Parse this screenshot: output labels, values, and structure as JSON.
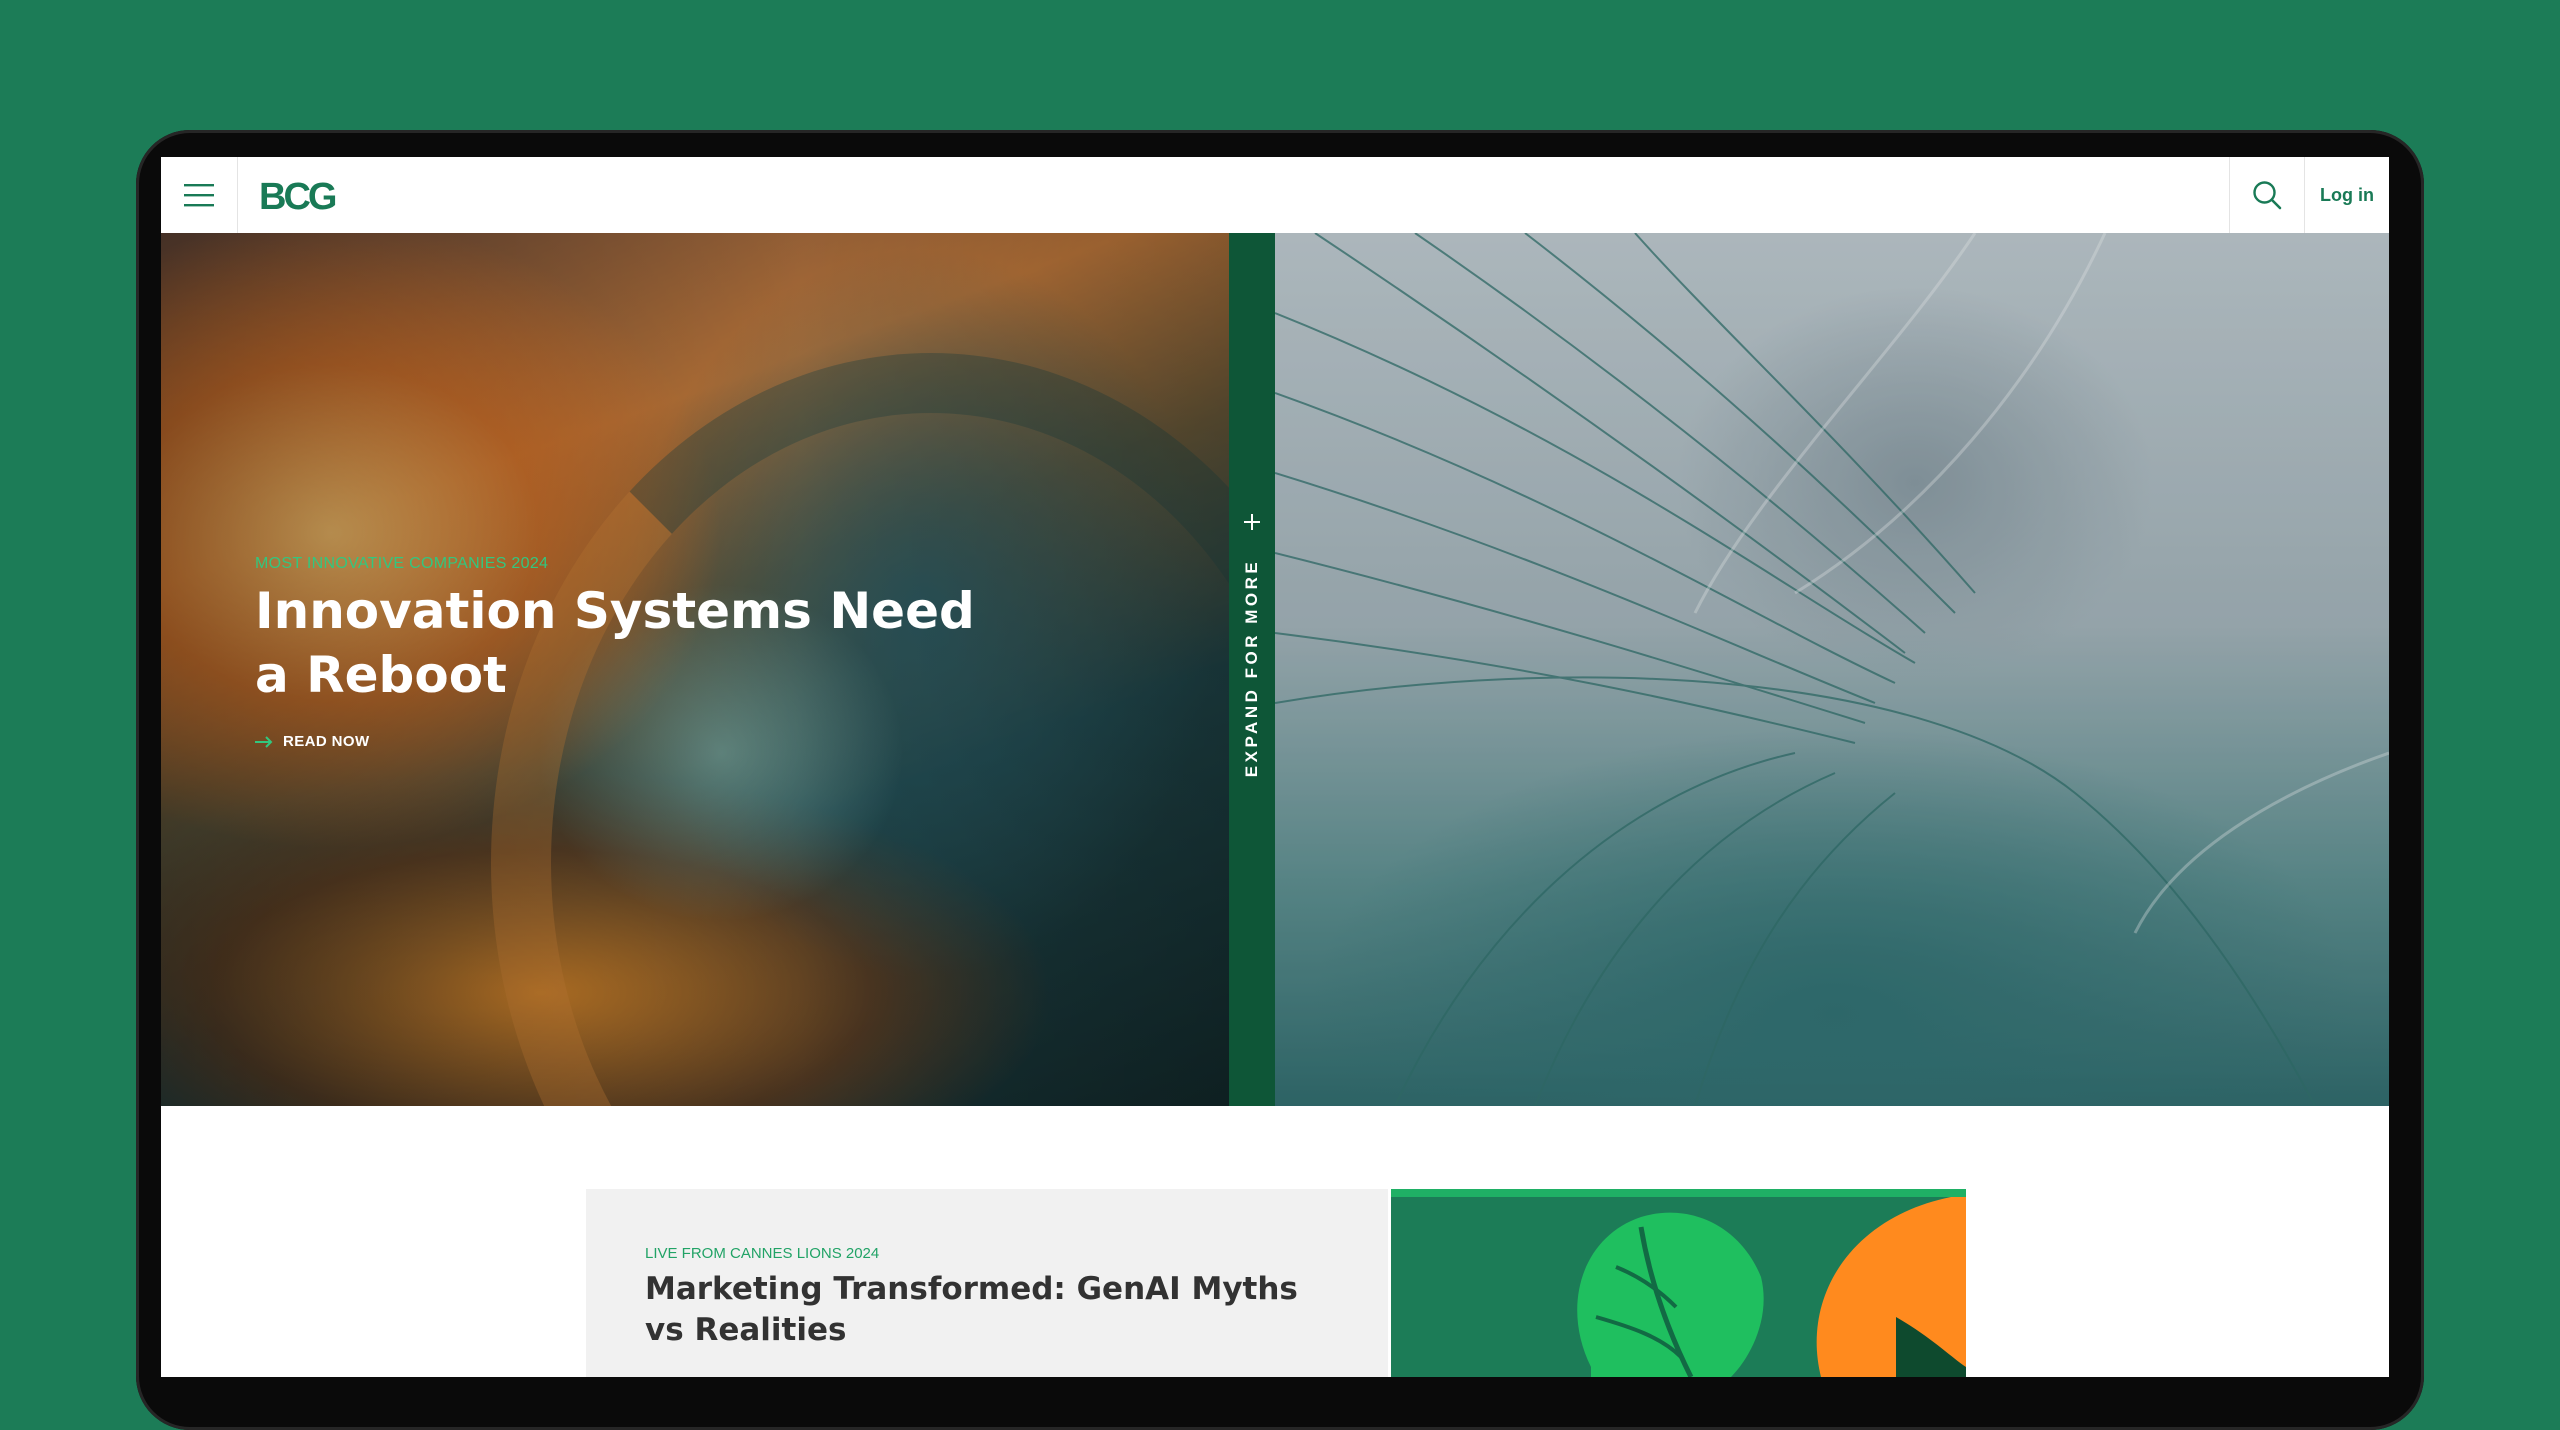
{
  "header": {
    "brand": "BCG",
    "login_label": "Log in"
  },
  "hero": {
    "eyebrow": "MOST INNOVATIVE COMPANIES 2024",
    "headline": "Innovation Systems Need a Reboot",
    "cta_label": "READ NOW",
    "expand_label": "EXPAND FOR MORE"
  },
  "feature_card": {
    "eyebrow": "LIVE FROM CANNES LIONS 2024",
    "title": "Marketing Transformed: GenAI Myths vs Realities"
  },
  "colors": {
    "brand_green": "#197a56",
    "accent_green": "#32c77f",
    "orange": "#ff8a1e",
    "page_background": "#1c7c57"
  },
  "icons": [
    "menu-icon",
    "search-icon",
    "arrow-right-icon",
    "plus-icon"
  ]
}
